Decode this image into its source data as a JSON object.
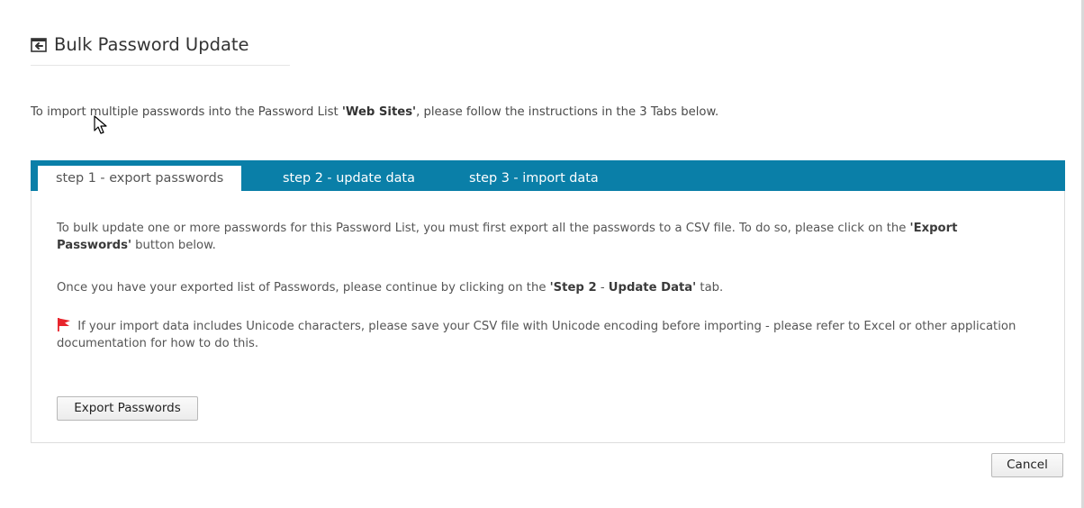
{
  "header": {
    "icon": "import-arrow-icon",
    "title": "Bulk Password Update"
  },
  "intro": {
    "prefix": "To import multiple passwords into the Password List ",
    "list_name": "'Web Sites'",
    "suffix": ", please follow the instructions in the 3 Tabs below."
  },
  "tabs": [
    {
      "label": "step 1 - export passwords",
      "active": true
    },
    {
      "label": "step 2 - update data",
      "active": false
    },
    {
      "label": "step 3 - import data",
      "active": false
    }
  ],
  "panel": {
    "p1_text": "To bulk update one or more passwords for this Password List, you must first export all the passwords to a CSV file. To do so, please click on the ",
    "p1_bold": "'Export Passwords'",
    "p1_end": " button below.",
    "p2_text": "Once you have your exported list of Passwords, please continue by clicking on the ",
    "p2_bold1": "'Step 2",
    "p2_sep": " - ",
    "p2_bold2": "Update Data'",
    "p2_end": " tab.",
    "p3_text": " If your import data includes Unicode characters, please save your CSV file with Unicode encoding before importing - please refer to Excel or other application documentation for how to do this.",
    "flag_icon": "red-flag-icon",
    "export_button": "Export Passwords"
  },
  "footer": {
    "cancel_button": "Cancel"
  },
  "colors": {
    "tabbar": "#0a7fa8",
    "flag": "#e8242c"
  }
}
